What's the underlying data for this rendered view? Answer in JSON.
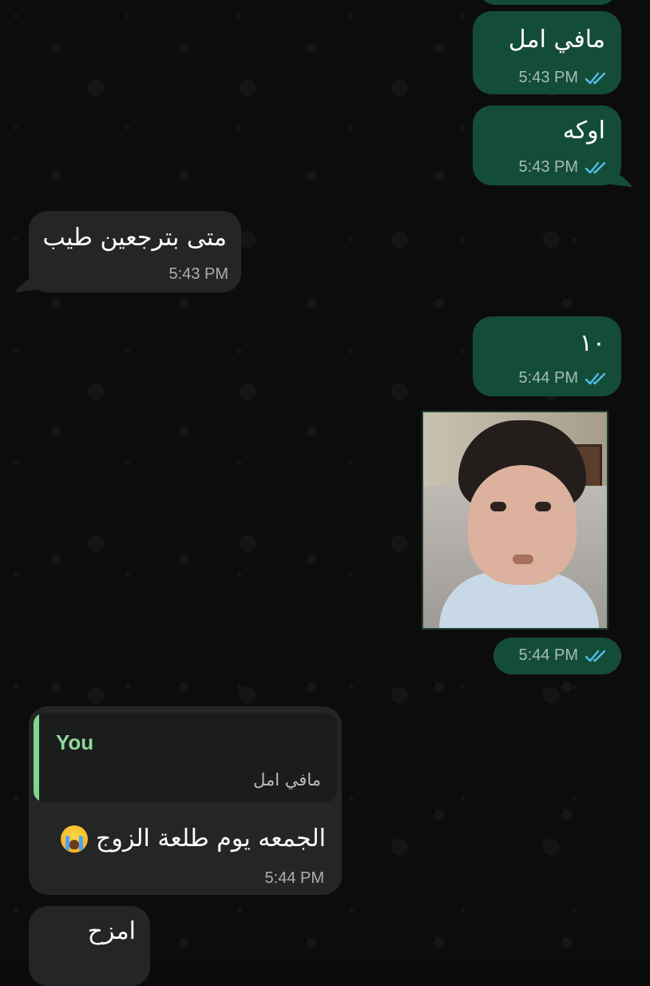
{
  "chat": {
    "messages": [
      {
        "id": "m1",
        "direction": "out",
        "text": "مافي امل",
        "time": "5:43 PM",
        "status": "read"
      },
      {
        "id": "m2",
        "direction": "out",
        "text": "اوكه",
        "time": "5:43 PM",
        "status": "read"
      },
      {
        "id": "m3",
        "direction": "in",
        "text": "متى بترجعين طيب",
        "time": "5:43 PM"
      },
      {
        "id": "m4",
        "direction": "out",
        "text": "١٠",
        "time": "5:44 PM",
        "status": "read"
      },
      {
        "id": "m5",
        "direction": "out",
        "type": "image",
        "time": "5:44 PM",
        "status": "read"
      },
      {
        "id": "m6",
        "direction": "in",
        "reply": {
          "sender": "You",
          "text": "مافي امل"
        },
        "text": "الجمعه يوم طلعة الزوج",
        "emoji": "crying-face",
        "time": "5:44 PM"
      },
      {
        "id": "m7",
        "direction": "in",
        "text": "امزح"
      }
    ]
  },
  "colors": {
    "outgoing_bubble": "#144d37",
    "incoming_bubble": "#242626",
    "read_ticks": "#53bdeb",
    "reply_accent": "#7fd88e",
    "background": "#0b0b0b"
  }
}
